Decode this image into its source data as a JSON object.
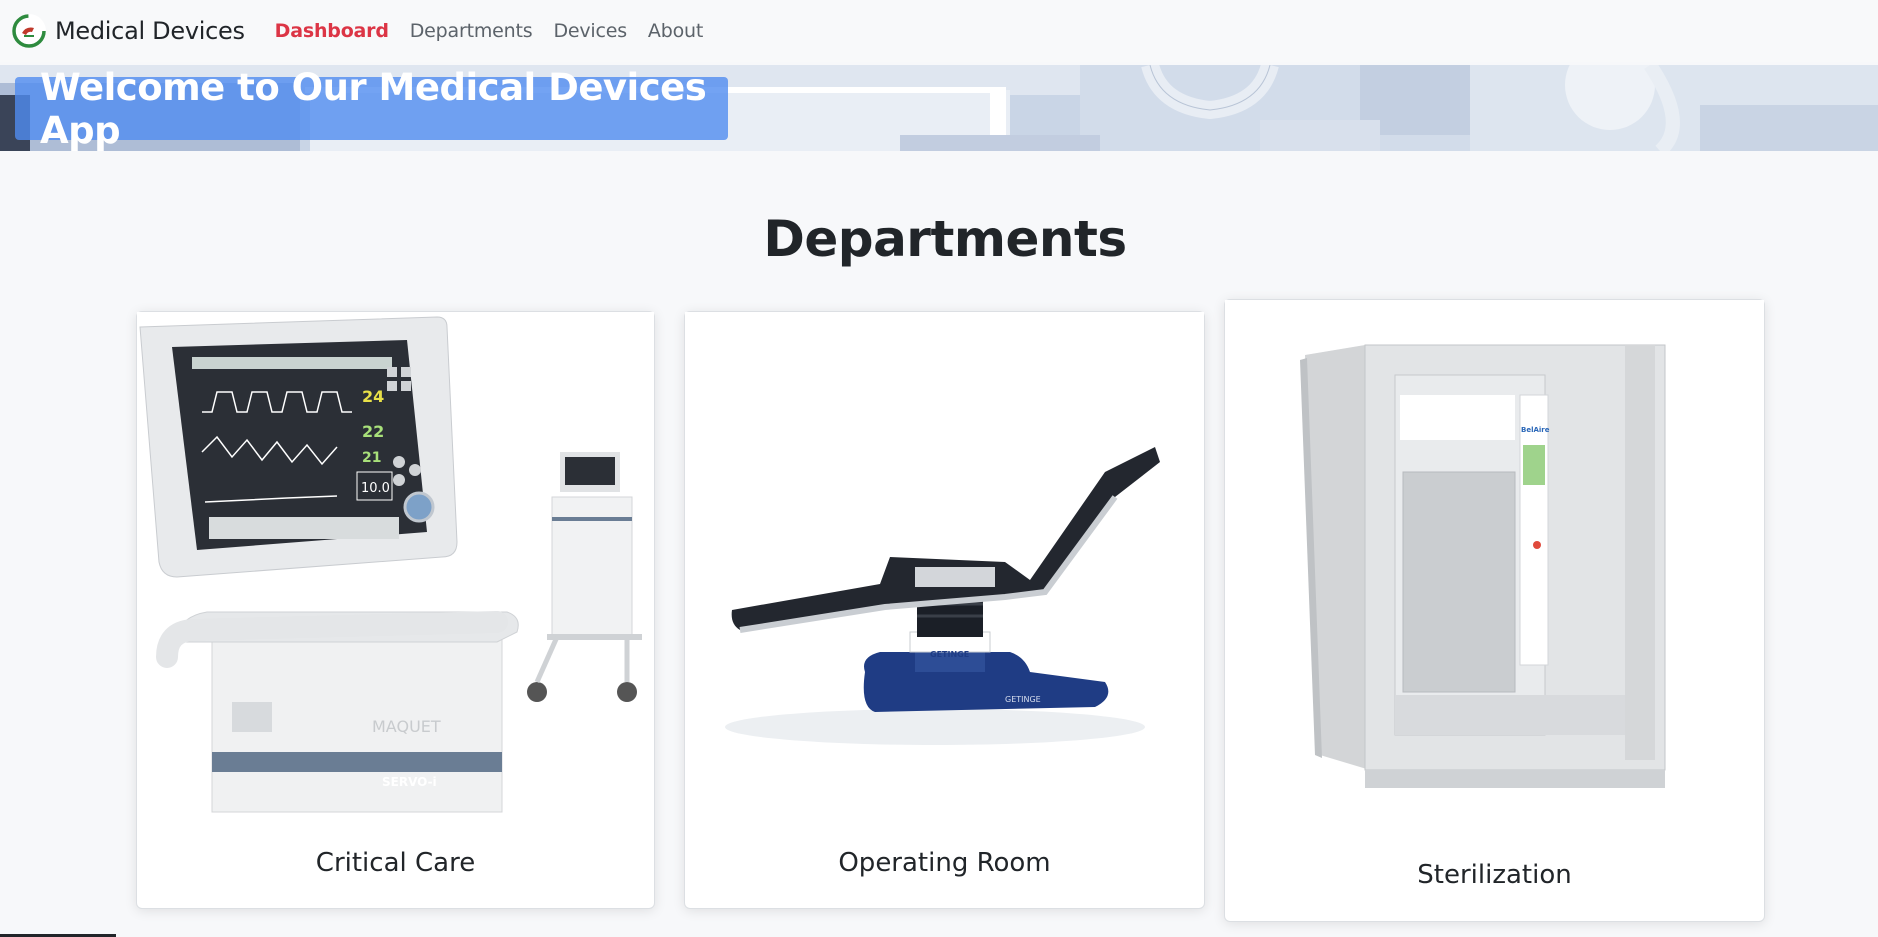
{
  "navbar": {
    "brand": "Medical Devices",
    "links": [
      {
        "label": "Dashboard",
        "active": true
      },
      {
        "label": "Departments",
        "active": false
      },
      {
        "label": "Devices",
        "active": false
      },
      {
        "label": "About",
        "active": false
      }
    ]
  },
  "hero": {
    "title": "Welcome to Our Medical Devices App"
  },
  "main": {
    "section_title": "Departments",
    "cards": [
      {
        "label": "Critical Care",
        "image": "ventilator-image"
      },
      {
        "label": "Operating Room",
        "image": "operating-table-image"
      },
      {
        "label": "Sterilization",
        "image": "sterilizer-image"
      }
    ]
  },
  "colors": {
    "accent_active": "#dc3545",
    "hero_box": "#508cf0",
    "background": "#f7f8fa"
  }
}
